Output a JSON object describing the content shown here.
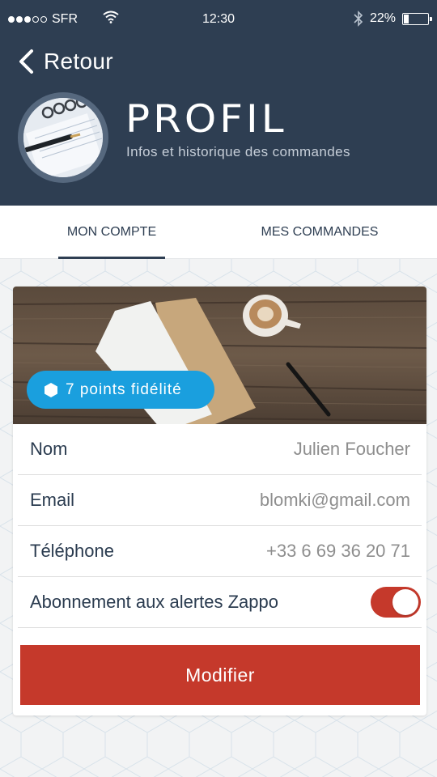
{
  "status_bar": {
    "carrier": "SFR",
    "time": "12:30",
    "battery": "22%",
    "battery_level": 0.22
  },
  "header": {
    "back_label": "Retour",
    "title": "PROFIL",
    "subtitle": "Infos et historique des commandes"
  },
  "tabs": [
    {
      "label": "MON COMPTE",
      "active": true
    },
    {
      "label": "MES COMMANDES",
      "active": false
    }
  ],
  "card": {
    "badge_label": "7 points fidélité",
    "fields": [
      {
        "label": "Nom",
        "value": "Julien Foucher"
      },
      {
        "label": "Email",
        "value": "blomki@gmail.com"
      },
      {
        "label": "Téléphone",
        "value": "+33 6 69 36 20 71"
      }
    ],
    "toggle": {
      "label": "Abonnement aux alertes Zappo",
      "on": true
    },
    "button_label": "Modifier"
  },
  "colors": {
    "header": "#2e3e52",
    "accent_red": "#c5392b",
    "badge_blue": "#1a9fde"
  }
}
